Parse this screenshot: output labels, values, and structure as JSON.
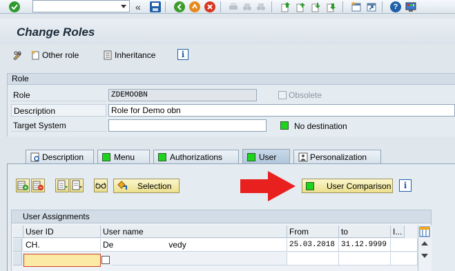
{
  "toolbar": {
    "command_field_value": "",
    "icons": [
      "enter-icon",
      "back-double-chevron-icon",
      "save-icon",
      "back-icon",
      "exit-icon",
      "cancel-icon",
      "print-icon",
      "find-icon",
      "find-next-icon",
      "first-page-icon",
      "previous-page-icon",
      "next-page-icon",
      "last-page-icon",
      "create-session-icon",
      "shortcut-icon",
      "help-icon",
      "layout-icon"
    ]
  },
  "page": {
    "title": "Change Roles"
  },
  "app_toolbar": {
    "other_role_label": "Other role",
    "inheritance_label": "Inheritance"
  },
  "role_group": {
    "header": "Role",
    "role_label": "Role",
    "role_value": "ZDEMOOBN",
    "obsolete_label": "Obsolete",
    "description_label": "Description",
    "description_value": "Role for Demo obn",
    "target_system_label": "Target System",
    "target_system_value": "",
    "target_status": "No destination"
  },
  "tabs": [
    {
      "label": "Description",
      "status": "none"
    },
    {
      "label": "Menu",
      "status": "green"
    },
    {
      "label": "Authorizations",
      "status": "green"
    },
    {
      "label": "User",
      "status": "green",
      "active": true
    },
    {
      "label": "Personalization",
      "status": "none"
    }
  ],
  "user_tab": {
    "selection_label": "Selection",
    "user_comparison_label": "User Comparison",
    "assignments_header": "User Assignments",
    "columns": [
      "User ID",
      "User name",
      "From",
      "to",
      "I..."
    ],
    "rows": [
      {
        "user_id": "CH.",
        "user_name": "De                        vedy",
        "from": "25.03.2018",
        "to": "31.12.9999",
        "i": ""
      },
      {
        "user_id": "",
        "user_name": "",
        "from": "",
        "to": "",
        "i": ""
      }
    ]
  },
  "colors": {
    "status_green": "#1ed31e",
    "annotation_arrow": "#e8201e",
    "button_yellow": "#f3ea9f"
  }
}
